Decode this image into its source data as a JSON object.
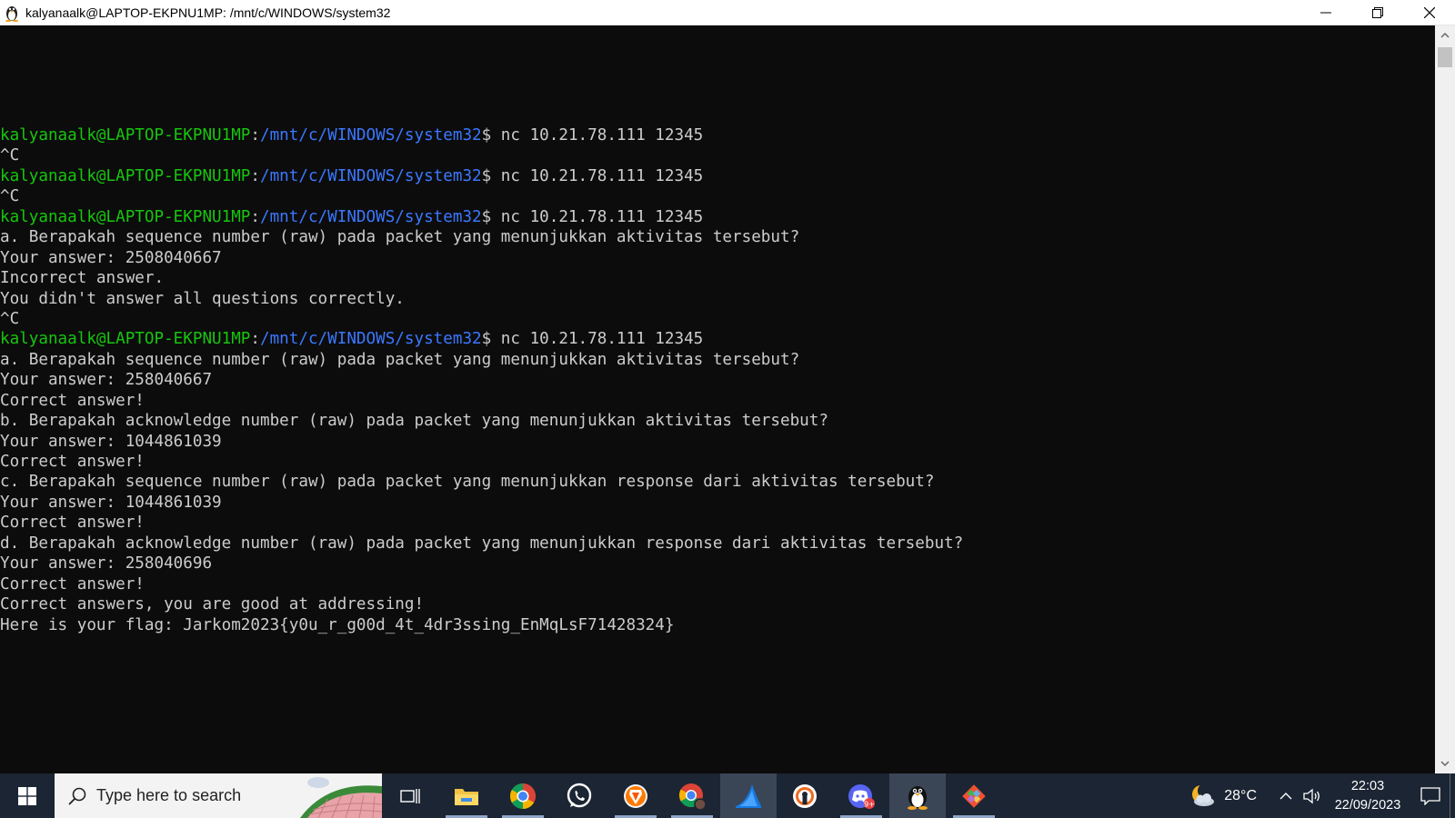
{
  "window": {
    "title": "kalyanaalk@LAPTOP-EKPNU1MP: /mnt/c/WINDOWS/system32",
    "icon": "linux-penguin-icon"
  },
  "terminal": {
    "prompt": {
      "user": "kalyanaalk@LAPTOP-EKPNU1MP",
      "sep": ":",
      "path": "/mnt/c/WINDOWS/system32",
      "dollar": "$"
    },
    "lines": [
      {
        "kind": "prompt",
        "cmd": " nc 10.21.78.111 12345"
      },
      {
        "kind": "text",
        "text": "^C"
      },
      {
        "kind": "prompt",
        "cmd": " nc 10.21.78.111 12345"
      },
      {
        "kind": "text",
        "text": "^C"
      },
      {
        "kind": "prompt",
        "cmd": " nc 10.21.78.111 12345"
      },
      {
        "kind": "text",
        "text": "a. Berapakah sequence number (raw) pada packet yang menunjukkan aktivitas tersebut?"
      },
      {
        "kind": "text",
        "text": "Your answer: 2508040667"
      },
      {
        "kind": "text",
        "text": "Incorrect answer."
      },
      {
        "kind": "text",
        "text": "You didn't answer all questions correctly."
      },
      {
        "kind": "text",
        "text": "^C"
      },
      {
        "kind": "prompt",
        "cmd": " nc 10.21.78.111 12345"
      },
      {
        "kind": "text",
        "text": "a. Berapakah sequence number (raw) pada packet yang menunjukkan aktivitas tersebut?"
      },
      {
        "kind": "text",
        "text": "Your answer: 258040667"
      },
      {
        "kind": "text",
        "text": "Correct answer!"
      },
      {
        "kind": "text",
        "text": "b. Berapakah acknowledge number (raw) pada packet yang menunjukkan aktivitas tersebut?"
      },
      {
        "kind": "text",
        "text": "Your answer: 1044861039"
      },
      {
        "kind": "text",
        "text": "Correct answer!"
      },
      {
        "kind": "text",
        "text": "c. Berapakah sequence number (raw) pada packet yang menunjukkan response dari aktivitas tersebut?"
      },
      {
        "kind": "text",
        "text": "Your answer: 1044861039"
      },
      {
        "kind": "text",
        "text": "Correct answer!"
      },
      {
        "kind": "text",
        "text": "d. Berapakah acknowledge number (raw) pada packet yang menunjukkan response dari aktivitas tersebut?"
      },
      {
        "kind": "text",
        "text": "Your answer: 258040696"
      },
      {
        "kind": "text",
        "text": "Correct answer!"
      },
      {
        "kind": "text",
        "text": "Correct answers, you are good at addressing!"
      },
      {
        "kind": "text",
        "text": "Here is your flag: Jarkom2023{y0u_r_g00d_4t_4dr3ssing_EnMqLsF71428324}"
      }
    ]
  },
  "taskbar": {
    "search_placeholder": "Type here to search",
    "apps": [
      {
        "name": "task-view-icon",
        "state": "none"
      },
      {
        "name": "file-explorer-icon",
        "state": "running"
      },
      {
        "name": "chrome-icon",
        "state": "running"
      },
      {
        "name": "whatsapp-icon",
        "state": "none"
      },
      {
        "name": "brave-icon",
        "state": "running"
      },
      {
        "name": "chrome-profile-icon",
        "state": "running"
      },
      {
        "name": "wireshark-icon",
        "state": "active"
      },
      {
        "name": "vpn-icon",
        "state": "none"
      },
      {
        "name": "discord-icon",
        "state": "running"
      },
      {
        "name": "linux-terminal-icon",
        "state": "active"
      },
      {
        "name": "git-icon",
        "state": "running"
      }
    ],
    "weather": {
      "temp": "28°C",
      "icon": "weather-moon-cloud-icon"
    },
    "clock": {
      "time": "22:03",
      "date": "22/09/2023"
    }
  },
  "colors": {
    "prompt_user": "#16c60c",
    "prompt_path": "#3b78ff",
    "terminal_text": "#cccccc",
    "terminal_bg": "#0c0c0c",
    "taskbar_bg": "#1b2533"
  }
}
